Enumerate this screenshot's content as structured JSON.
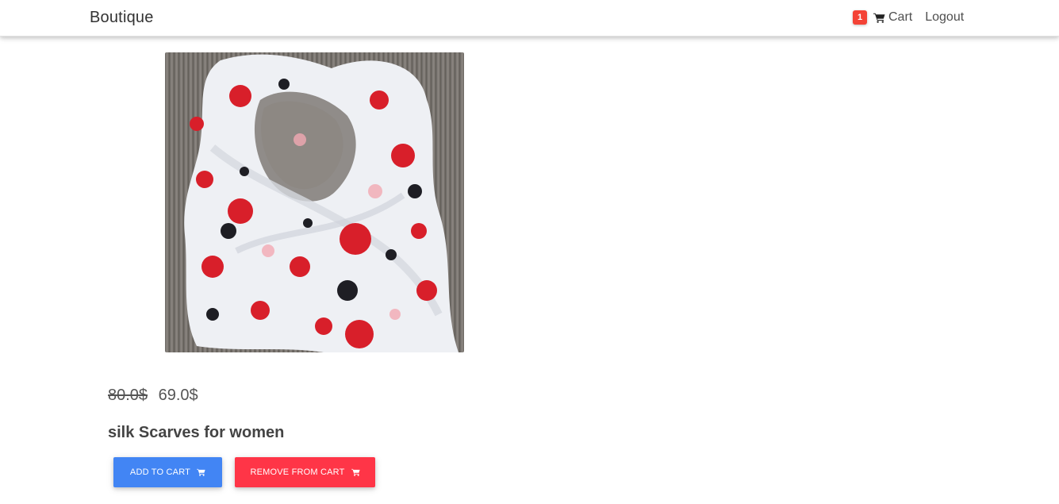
{
  "navbar": {
    "brand": "Boutique",
    "cart_count": "1",
    "cart_label": "Cart",
    "logout_label": "Logout"
  },
  "product": {
    "old_price": "80.0$",
    "price": "69.0$",
    "title": "silk Scarves for women",
    "image_description": "floral silk scarf"
  },
  "actions": {
    "add_label": "ADD TO CART",
    "remove_label": "REMOVE FROM CART"
  },
  "colors": {
    "add_button": "#4285f4",
    "remove_button": "#ff3547",
    "badge": "#f44336"
  },
  "icons": {
    "cart": "shopping-cart-icon"
  }
}
